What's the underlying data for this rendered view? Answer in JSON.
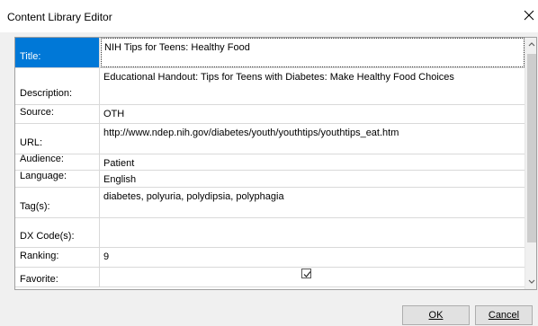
{
  "window": {
    "title": "Content Library Editor",
    "close_icon": "close-icon"
  },
  "fields": [
    {
      "label": "Title:",
      "value": "NIH Tips for Teens: Healthy Food",
      "selected": true
    },
    {
      "label": "Description:",
      "value": "Educational Handout: Tips for Teens with Diabetes: Make Healthy Food Choices"
    },
    {
      "label": "Source:",
      "value": "OTH"
    },
    {
      "label": "URL:",
      "value": "http://www.ndep.nih.gov/diabetes/youth/youthtips/youthtips_eat.htm"
    },
    {
      "label": "Audience:",
      "value": "Patient"
    },
    {
      "label": "Language:",
      "value": "English"
    },
    {
      "label": "Tag(s):",
      "value": "diabetes, polyuria, polydipsia, polyphagia"
    },
    {
      "label": "DX Code(s):",
      "value": ""
    },
    {
      "label": "Ranking:",
      "value": "9"
    },
    {
      "label": "Favorite:",
      "value": "",
      "checked": true
    }
  ],
  "buttons": {
    "ok_label": "OK",
    "cancel_label": "Cancel"
  },
  "colors": {
    "selection": "#0078d7",
    "dialog_bg": "#f0f0f0",
    "button_bg": "#e1e1e1"
  }
}
